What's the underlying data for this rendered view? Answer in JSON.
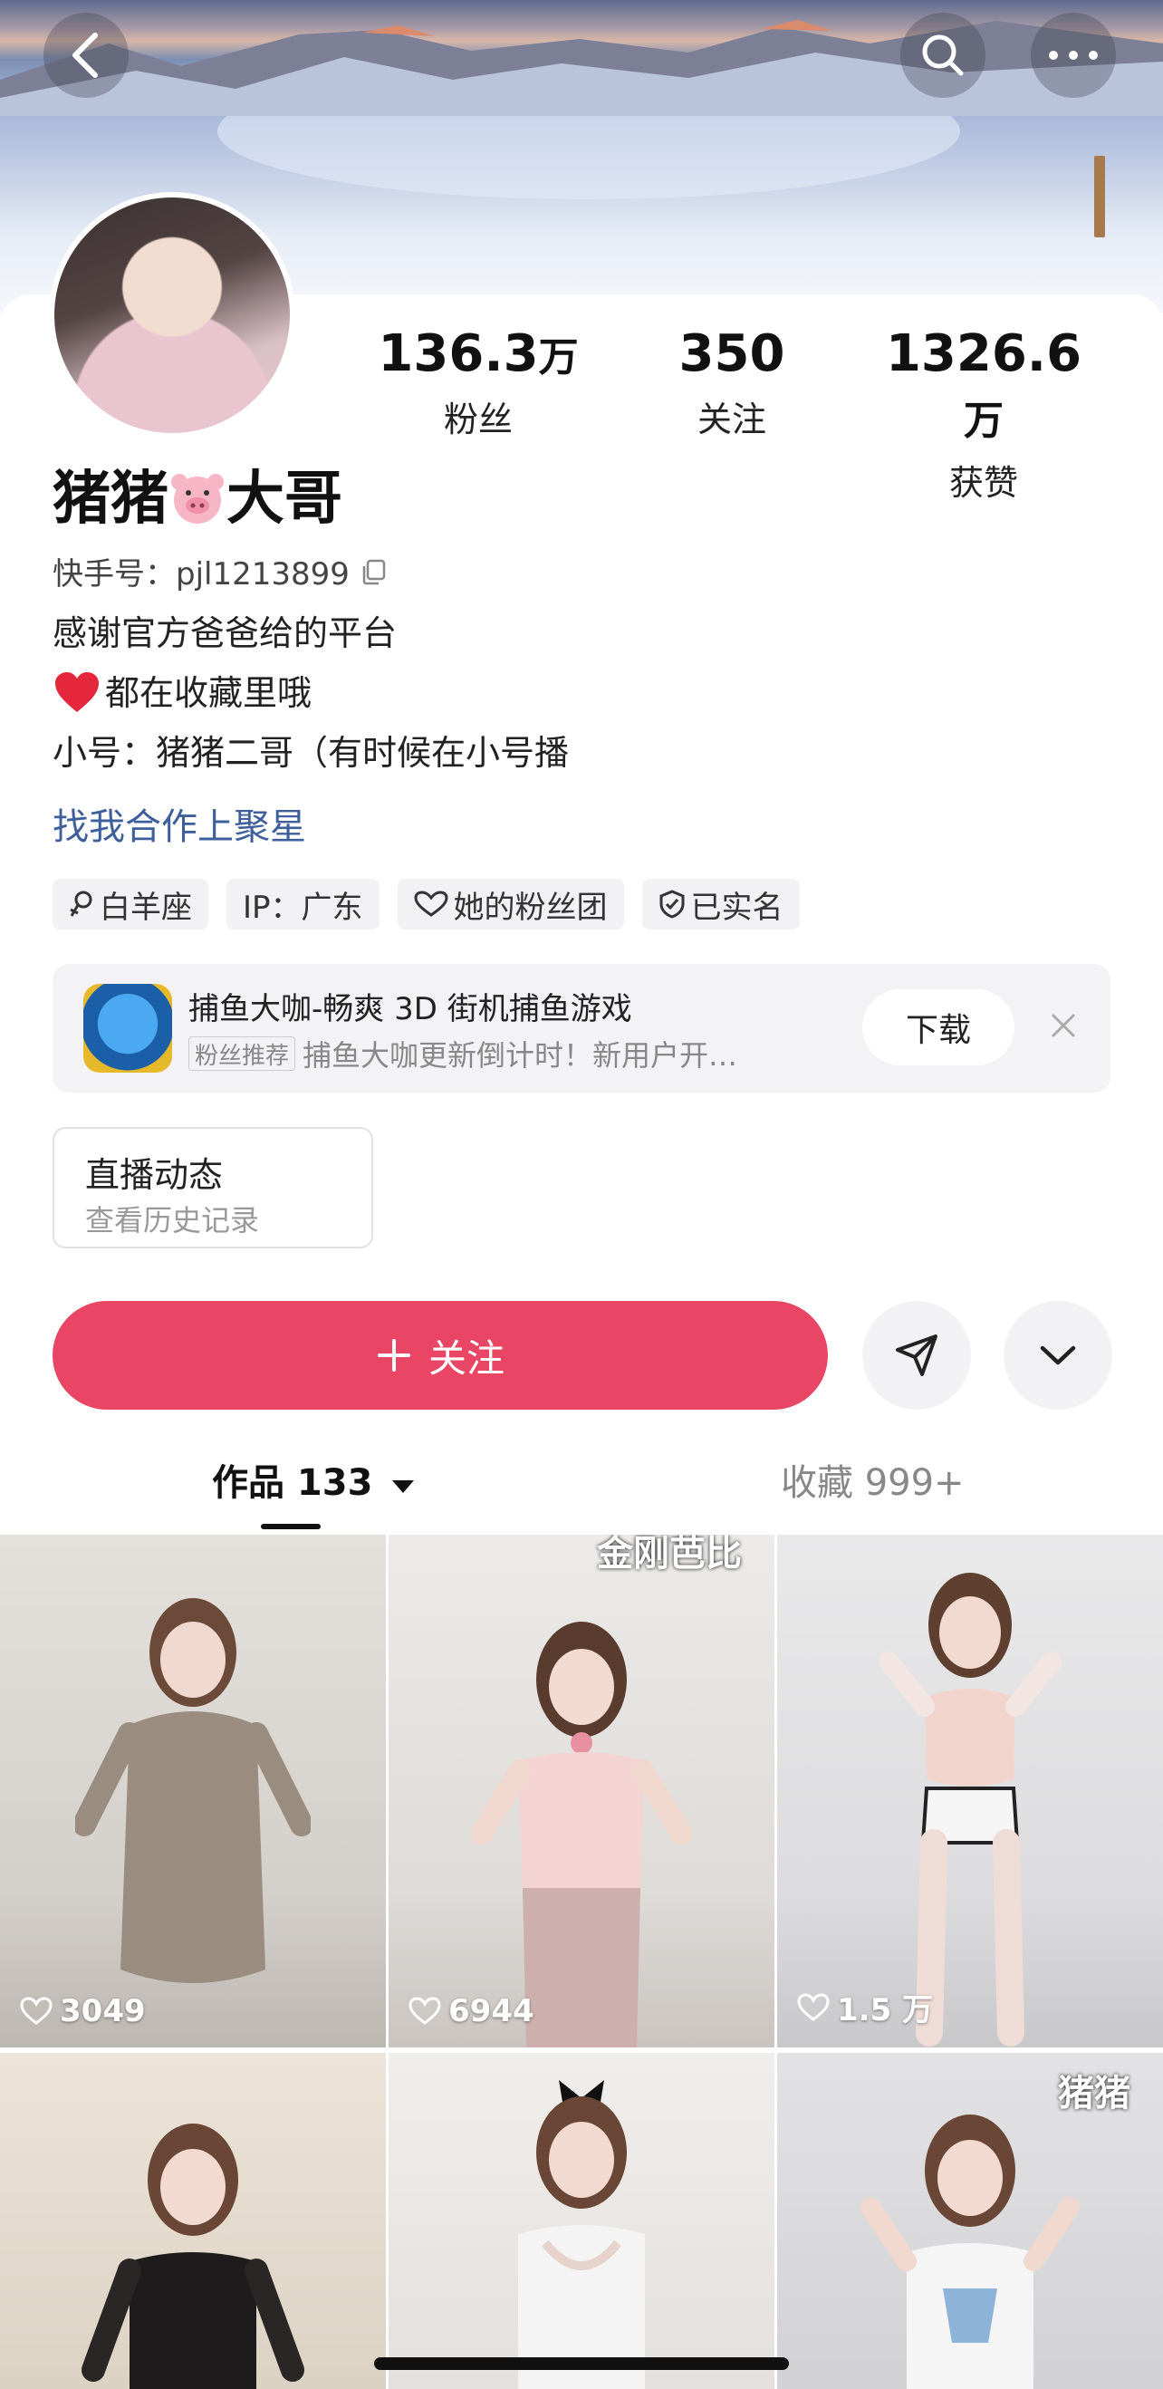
{
  "profile": {
    "name": "猪猪",
    "name_suffix": "大哥",
    "uid": "快手号：pjl1213899",
    "bio": [
      "感谢官方爸爸给的平台",
      "都在收藏里哦",
      "小号：猪猪二哥（有时候在小号播"
    ],
    "link": "找我合作上聚星"
  },
  "stats": [
    {
      "num": "136.3",
      "unit": "万",
      "label": "粉丝"
    },
    {
      "num": "350",
      "unit": "",
      "label": "关注"
    },
    {
      "num": "1326.6",
      "unit": "万",
      "label": "获赞"
    }
  ],
  "tags": [
    "白羊座",
    "IP：广东",
    "她的粉丝团",
    "已实名"
  ],
  "ad": {
    "title": "捕鱼大咖-畅爽 3D 街机捕鱼游戏",
    "badge": "粉丝推荐",
    "desc": "捕鱼大咖更新倒计时！新用户开…",
    "download": "下载"
  },
  "live": {
    "title": "直播动态",
    "sub": "查看历史记录"
  },
  "actions": {
    "follow": "关注"
  },
  "tabs": {
    "works": "作品 133",
    "favs": "收藏 999+"
  },
  "videos": [
    {
      "likes": "3049",
      "overlay": ""
    },
    {
      "likes": "6944",
      "overlay": "金刚芭比"
    },
    {
      "likes": "1.5 万",
      "overlay": ""
    },
    {
      "likes": "",
      "overlay": ""
    },
    {
      "likes": "",
      "overlay": ""
    },
    {
      "likes": "",
      "overlay": "猪猪"
    }
  ],
  "colors": {
    "accent": "#e94665",
    "link": "#3e5f9c"
  }
}
